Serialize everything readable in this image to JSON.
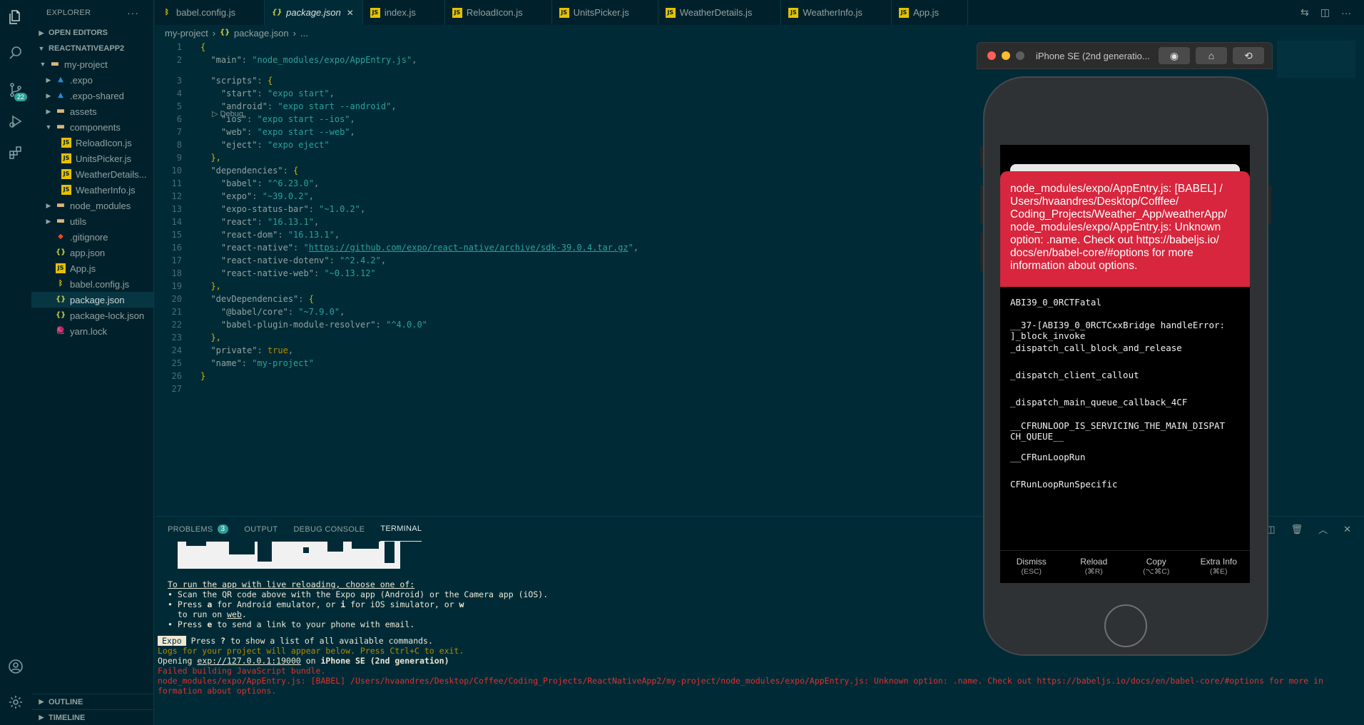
{
  "explorer": {
    "title": "EXPLORER",
    "more": "···",
    "open_editors": "OPEN EDITORS",
    "project": "REACTNATIVEAPP2",
    "tree": [
      {
        "label": "my-project",
        "type": "folder",
        "open": true
      },
      {
        "label": ".expo",
        "type": "exp"
      },
      {
        "label": ".expo-shared",
        "type": "exp"
      },
      {
        "label": "assets",
        "type": "folder"
      },
      {
        "label": "components",
        "type": "folder",
        "open": true
      },
      {
        "label": "ReloadIcon.js",
        "type": "js"
      },
      {
        "label": "UnitsPicker.js",
        "type": "js"
      },
      {
        "label": "WeatherDetails...",
        "type": "js"
      },
      {
        "label": "WeatherInfo.js",
        "type": "js"
      },
      {
        "label": "node_modules",
        "type": "folder"
      },
      {
        "label": "utils",
        "type": "folder"
      },
      {
        "label": ".gitignore",
        "type": "git"
      },
      {
        "label": "app.json",
        "type": "json"
      },
      {
        "label": "App.js",
        "type": "js"
      },
      {
        "label": "babel.config.js",
        "type": "babel"
      },
      {
        "label": "package.json",
        "type": "json",
        "active": true
      },
      {
        "label": "package-lock.json",
        "type": "json"
      },
      {
        "label": "yarn.lock",
        "type": "yarn"
      }
    ],
    "outline": "OUTLINE",
    "timeline": "TIMELINE"
  },
  "activity": {
    "scm_badge": "22"
  },
  "tabs": [
    {
      "label": "babel.config.js",
      "type": "babel"
    },
    {
      "label": "package.json",
      "type": "json",
      "active": true
    },
    {
      "label": "index.js",
      "type": "js"
    },
    {
      "label": "ReloadIcon.js",
      "type": "js"
    },
    {
      "label": "UnitsPicker.js",
      "type": "js"
    },
    {
      "label": "WeatherDetails.js",
      "type": "js"
    },
    {
      "label": "WeatherInfo.js",
      "type": "js"
    },
    {
      "label": "App.js",
      "type": "js"
    }
  ],
  "breadcrumb": {
    "folder": "my-project",
    "file": "package.json",
    "tail": "..."
  },
  "editor": {
    "codelens": "▷ Debug",
    "lines": [
      [
        {
          "t": "{",
          "c": "brace"
        }
      ],
      [
        {
          "t": "  \"main\"",
          "c": "key"
        },
        {
          "t": ": ",
          "c": "punct"
        },
        {
          "t": "\"node_modules/expo/AppEntry.js\"",
          "c": "str"
        },
        {
          "t": ",",
          "c": "punct"
        }
      ],
      [
        {
          "t": "  \"scripts\"",
          "c": "key"
        },
        {
          "t": ": ",
          "c": "punct"
        },
        {
          "t": "{",
          "c": "brace"
        }
      ],
      [
        {
          "t": "    \"start\"",
          "c": "key"
        },
        {
          "t": ": ",
          "c": "punct"
        },
        {
          "t": "\"expo start\"",
          "c": "str"
        },
        {
          "t": ",",
          "c": "punct"
        }
      ],
      [
        {
          "t": "    \"android\"",
          "c": "key"
        },
        {
          "t": ": ",
          "c": "punct"
        },
        {
          "t": "\"expo start --android\"",
          "c": "str"
        },
        {
          "t": ",",
          "c": "punct"
        }
      ],
      [
        {
          "t": "    \"ios\"",
          "c": "key"
        },
        {
          "t": ": ",
          "c": "punct"
        },
        {
          "t": "\"expo start --ios\"",
          "c": "str"
        },
        {
          "t": ",",
          "c": "punct"
        }
      ],
      [
        {
          "t": "    \"web\"",
          "c": "key"
        },
        {
          "t": ": ",
          "c": "punct"
        },
        {
          "t": "\"expo start --web\"",
          "c": "str"
        },
        {
          "t": ",",
          "c": "punct"
        }
      ],
      [
        {
          "t": "    \"eject\"",
          "c": "key"
        },
        {
          "t": ": ",
          "c": "punct"
        },
        {
          "t": "\"expo eject\"",
          "c": "str"
        }
      ],
      [
        {
          "t": "  },",
          "c": "brace"
        }
      ],
      [
        {
          "t": "  \"dependencies\"",
          "c": "key"
        },
        {
          "t": ": ",
          "c": "punct"
        },
        {
          "t": "{",
          "c": "brace"
        }
      ],
      [
        {
          "t": "    \"babel\"",
          "c": "key"
        },
        {
          "t": ": ",
          "c": "punct"
        },
        {
          "t": "\"^6.23.0\"",
          "c": "str"
        },
        {
          "t": ",",
          "c": "punct"
        }
      ],
      [
        {
          "t": "    \"expo\"",
          "c": "key"
        },
        {
          "t": ": ",
          "c": "punct"
        },
        {
          "t": "\"~39.0.2\"",
          "c": "str"
        },
        {
          "t": ",",
          "c": "punct"
        }
      ],
      [
        {
          "t": "    \"expo-status-bar\"",
          "c": "key"
        },
        {
          "t": ": ",
          "c": "punct"
        },
        {
          "t": "\"~1.0.2\"",
          "c": "str"
        },
        {
          "t": ",",
          "c": "punct"
        }
      ],
      [
        {
          "t": "    \"react\"",
          "c": "key"
        },
        {
          "t": ": ",
          "c": "punct"
        },
        {
          "t": "\"16.13.1\"",
          "c": "str"
        },
        {
          "t": ",",
          "c": "punct"
        }
      ],
      [
        {
          "t": "    \"react-dom\"",
          "c": "key"
        },
        {
          "t": ": ",
          "c": "punct"
        },
        {
          "t": "\"16.13.1\"",
          "c": "str"
        },
        {
          "t": ",",
          "c": "punct"
        }
      ],
      [
        {
          "t": "    \"react-native\"",
          "c": "key"
        },
        {
          "t": ": ",
          "c": "punct"
        },
        {
          "t": "\"",
          "c": "str"
        },
        {
          "t": "https://github.com/expo/react-native/archive/sdk-39.0.4.tar.gz",
          "c": "link"
        },
        {
          "t": "\"",
          "c": "str"
        },
        {
          "t": ",",
          "c": "punct"
        }
      ],
      [
        {
          "t": "    \"react-native-dotenv\"",
          "c": "key"
        },
        {
          "t": ": ",
          "c": "punct"
        },
        {
          "t": "\"^2.4.2\"",
          "c": "str"
        },
        {
          "t": ",",
          "c": "punct"
        }
      ],
      [
        {
          "t": "    \"react-native-web\"",
          "c": "key"
        },
        {
          "t": ": ",
          "c": "punct"
        },
        {
          "t": "\"~0.13.12\"",
          "c": "str"
        }
      ],
      [
        {
          "t": "  },",
          "c": "brace"
        }
      ],
      [
        {
          "t": "  \"devDependencies\"",
          "c": "key"
        },
        {
          "t": ": ",
          "c": "punct"
        },
        {
          "t": "{",
          "c": "brace"
        }
      ],
      [
        {
          "t": "    \"@babel/core\"",
          "c": "key"
        },
        {
          "t": ": ",
          "c": "punct"
        },
        {
          "t": "\"~7.9.0\"",
          "c": "str"
        },
        {
          "t": ",",
          "c": "punct"
        }
      ],
      [
        {
          "t": "    \"babel-plugin-module-resolver\"",
          "c": "key"
        },
        {
          "t": ": ",
          "c": "punct"
        },
        {
          "t": "\"^4.0.0\"",
          "c": "str"
        }
      ],
      [
        {
          "t": "  },",
          "c": "brace"
        }
      ],
      [
        {
          "t": "  \"private\"",
          "c": "key"
        },
        {
          "t": ": ",
          "c": "punct"
        },
        {
          "t": "true",
          "c": "bool"
        },
        {
          "t": ",",
          "c": "punct"
        }
      ],
      [
        {
          "t": "  \"name\"",
          "c": "key"
        },
        {
          "t": ": ",
          "c": "punct"
        },
        {
          "t": "\"my-project\"",
          "c": "str"
        }
      ],
      [
        {
          "t": "}",
          "c": "brace"
        }
      ],
      []
    ]
  },
  "panel": {
    "tabs": [
      {
        "label": "PROBLEMS",
        "count": "3"
      },
      {
        "label": "OUTPUT"
      },
      {
        "label": "DEBUG CONSOLE"
      },
      {
        "label": "TERMINAL",
        "active": true
      }
    ],
    "terminal": {
      "run_heading": "To run the app with live reloading, choose one of:",
      "bullet1": "• Scan the QR code above with the Expo app (Android) or the Camera app (iOS).",
      "bullet2a": "• Press ",
      "bullet2_a": "a",
      "bullet2b": " for Android emulator, or ",
      "bullet2_i": "i",
      "bullet2c": " for iOS simulator, or ",
      "bullet2_w": "w",
      "bullet2d": "  to run on ",
      "bullet2_web": "web",
      "bullet2e": ".",
      "bullet3a": "• Press ",
      "bullet3_e": "e",
      "bullet3b": " to send a link to your phone with email.",
      "expo_pill": "Expo",
      "press_help_a": " Press ",
      "press_help_q": "?",
      "press_help_b": " to show a list of all available commands.",
      "logs_line": "Logs for your project will appear below. Press Ctrl+C to exit.",
      "opening_a": "Opening ",
      "opening_url": "exp://127.0.0.1:19000",
      "opening_b": " on ",
      "opening_device": "iPhone SE (2nd generation)",
      "failed": "Failed building JavaScript bundle.",
      "error1": "node_modules/expo/AppEntry.js: [BABEL] /Users/hvaandres/Desktop/Coffee/Coding_Projects/ReactNativeApp2/my-project/node_modules/expo/AppEntry.js: Unknown option: .name. Check out https://babeljs.io/docs/en/babel-core/#options for more in",
      "error2": "formation about options."
    }
  },
  "simulator": {
    "title": "iPhone SE (2nd generatio...",
    "error_message": "node_modules/expo/AppEntry.js: [BABEL] / Users/hvaandres/Desktop/Cofffee/ Coding_Projects/Weather_App/weatherApp/ node_modules/expo/AppEntry.js: Unknown option: .name. Check out https://babeljs.io/ docs/en/babel-core/#options for more information about options.",
    "stack": [
      "ABI39_0_0RCTFatal",
      "__37-[ABI39_0_0RCTCxxBridge handleError:\n]_block_invoke",
      "_dispatch_call_block_and_release",
      "_dispatch_client_callout",
      "_dispatch_main_queue_callback_4CF",
      "__CFRUNLOOP_IS_SERVICING_THE_MAIN_DISPAT\nCH_QUEUE__",
      "__CFRunLoopRun",
      "CFRunLoopRunSpecific"
    ],
    "actions": [
      {
        "label": "Dismiss",
        "shortcut": "(ESC)"
      },
      {
        "label": "Reload",
        "shortcut": "(⌘R)"
      },
      {
        "label": "Copy",
        "shortcut": "(⌥⌘C)"
      },
      {
        "label": "Extra Info",
        "shortcut": "(⌘E)"
      }
    ]
  },
  "colors": {
    "background": "#002b36",
    "sidebar": "#00212b",
    "string": "#2aa198",
    "brace": "#d0b400",
    "error_red": "#dc322f",
    "redbox": "#d7263d"
  }
}
